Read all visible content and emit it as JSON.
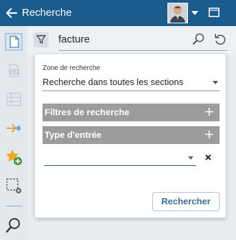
{
  "header": {
    "title": "Recherche",
    "back_icon": "arrow-left-icon",
    "user_avatar": "user-avatar",
    "menu_icon": "caret-down-icon",
    "window_icon": "window-icon",
    "background_color": "#1b5c8f"
  },
  "sidebar": {
    "items": [
      {
        "icon": "document-icon",
        "active": true
      },
      {
        "icon": "view-document-icon",
        "active": false
      },
      {
        "icon": "list-icon",
        "active": false
      },
      {
        "icon": "login-arrow-icon",
        "active": false
      },
      {
        "icon": "star-add-icon",
        "active": false
      },
      {
        "icon": "selection-settings-icon",
        "active": false
      },
      {
        "icon": "search-icon",
        "active": false
      }
    ]
  },
  "searchbar": {
    "query": "facture",
    "filter_icon": "filter-icon",
    "search_icon": "search-icon",
    "reset_icon": "reset-icon"
  },
  "panel": {
    "zone_label": "Zone de recherche",
    "zone_value": "Recherche dans toutes les sections",
    "filters_label": "Filtres de recherche",
    "entry_type_label": "Type d'entrée",
    "entry_type_value": "",
    "submit_label": "Rechercher"
  }
}
